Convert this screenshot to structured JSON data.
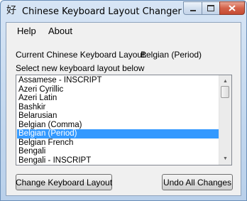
{
  "window": {
    "title": "Chinese Keyboard Layout Changer",
    "app_icon_glyph": "好"
  },
  "menu": {
    "help": "Help",
    "about": "About"
  },
  "current_layout": {
    "label": "Current Chinese Keyboard Layout:",
    "value": "Belgian (Period)"
  },
  "select_prompt": "Select new keyboard layout below",
  "layouts": [
    "Assamese - INSCRIPT",
    "Azeri Cyrillic",
    "Azeri Latin",
    "Bashkir",
    "Belarusian",
    "Belgian (Comma)",
    "Belgian (Period)",
    "Belgian French",
    "Bengali",
    "Bengali - INSCRIPT"
  ],
  "selected_layout": "Belgian (Period)",
  "buttons": {
    "change": "Change Keyboard Layout",
    "undo": "Undo All Changes"
  },
  "colors": {
    "selection": "#3399ff",
    "close_button": "#c44a32"
  }
}
